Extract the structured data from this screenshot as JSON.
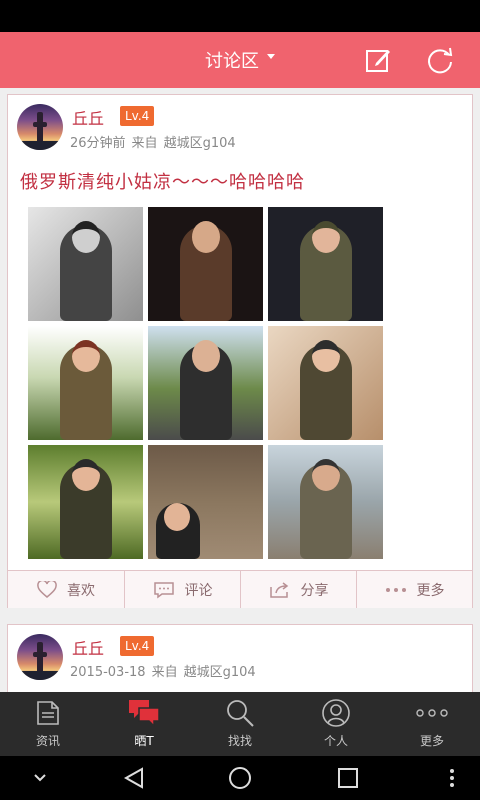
{
  "header": {
    "title": "讨论区",
    "icons": [
      "edit-icon",
      "refresh-icon",
      "dropdown-caret-icon"
    ]
  },
  "posts": [
    {
      "author": "丘丘",
      "level": "Lv.4",
      "time": "26分钟前",
      "from_label": "来自",
      "location": "越城区g104",
      "title": "俄罗斯清纯小姑凉～～～哈哈哈哈",
      "images_count": 9
    },
    {
      "author": "丘丘",
      "level": "Lv.4",
      "time": "2015-03-18",
      "from_label": "来自",
      "location": "越城区g104"
    }
  ],
  "actions": [
    {
      "icon": "heart-icon",
      "label": "喜欢"
    },
    {
      "icon": "comment-icon",
      "label": "评论"
    },
    {
      "icon": "share-icon",
      "label": "分享"
    },
    {
      "icon": "more-dots-icon",
      "label": "更多"
    }
  ],
  "bottom_nav": [
    {
      "icon": "news-icon",
      "label": "资讯",
      "active": false
    },
    {
      "icon": "chat-bubbles-icon",
      "label": "晒T",
      "active": true
    },
    {
      "icon": "search-icon",
      "label": "找找",
      "active": false
    },
    {
      "icon": "person-icon",
      "label": "个人",
      "active": false
    },
    {
      "icon": "more-dots-icon",
      "label": "更多",
      "active": false
    }
  ],
  "colors": {
    "accent": "#f0636e",
    "title_red": "#c23042",
    "badge_orange": "#ef6a30",
    "nav_bg": "#2b2b2b",
    "active_nav_icon": "#e0313a"
  }
}
